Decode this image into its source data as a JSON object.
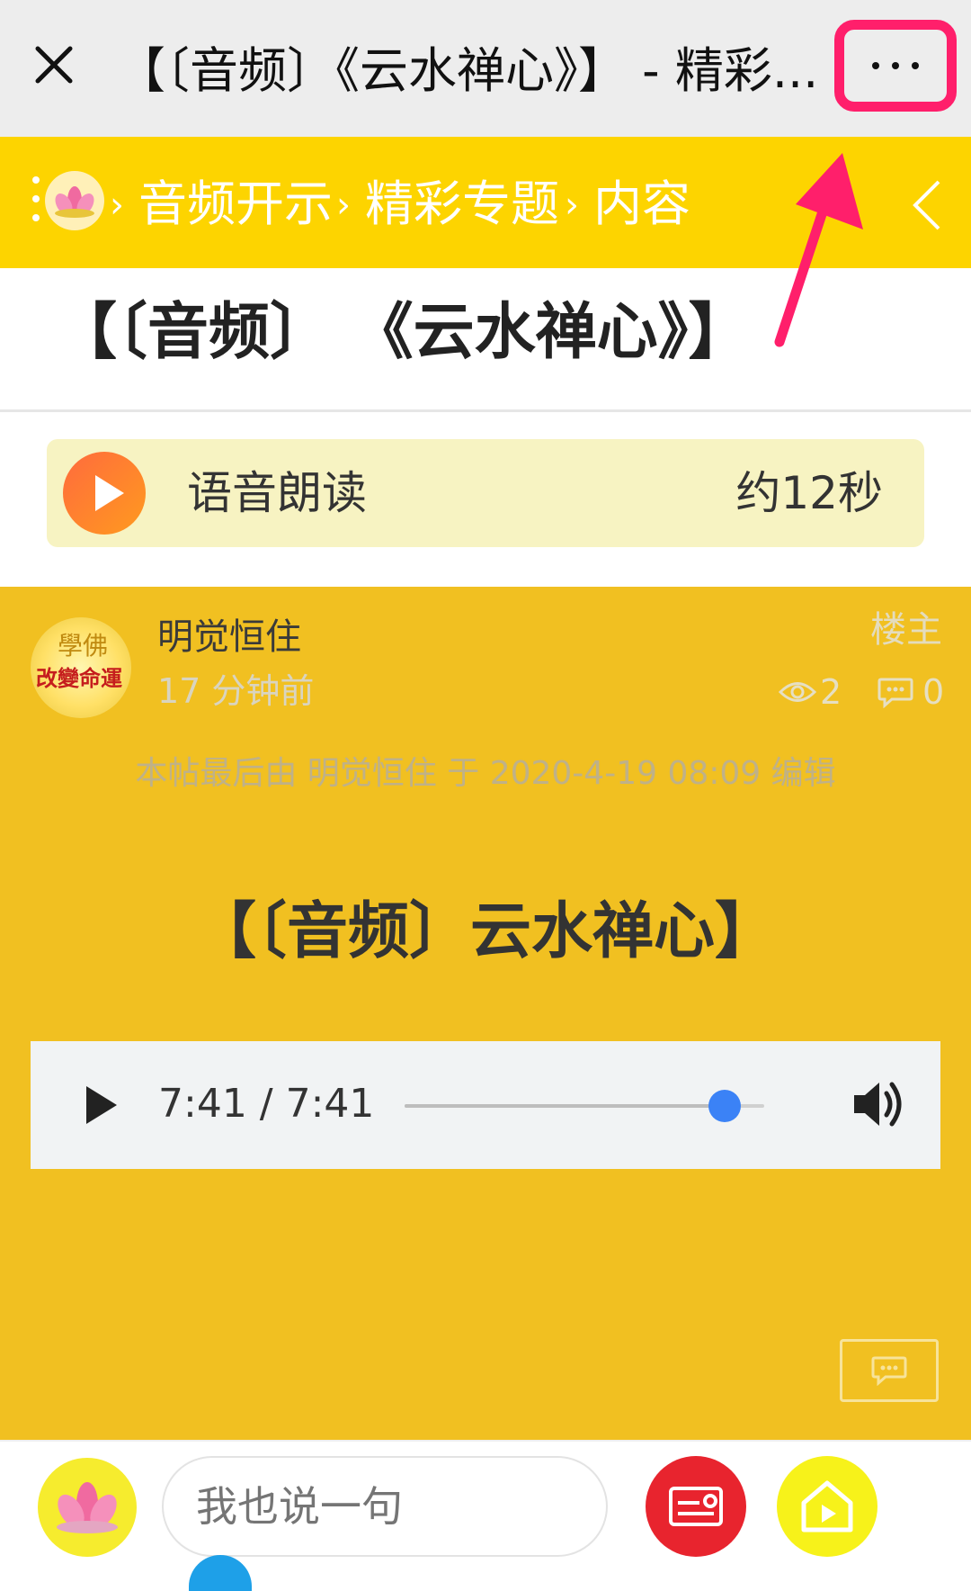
{
  "window": {
    "title": "【〔音频〕《云水禅心》】 - 精彩...",
    "close_icon": "close-icon",
    "more_icon": "more-dots-icon",
    "highlight_color": "#ff1f6b"
  },
  "breadcrumb": {
    "items": [
      "音频开示",
      "精彩专题",
      "内容"
    ],
    "separator": "›",
    "bar_color": "#fdd400"
  },
  "page": {
    "title": "【〔音频〕 《云水禅心》】"
  },
  "tts": {
    "label": "语音朗读",
    "duration": "约12秒"
  },
  "post": {
    "author": "明觉恒住",
    "time": "17 分钟前",
    "owner_badge": "楼主",
    "views": "2",
    "comments": "0",
    "edit_note": "本帖最后由 明觉恒住 于 2020-4-19 08:09 编辑",
    "title": "【〔音频〕云水禅心】",
    "avatar_text_top": "學佛",
    "avatar_text_bottom": "改變命運",
    "background": "#f1c021"
  },
  "audio_player": {
    "time": "7:41 / 7:41",
    "progress": 0.89
  },
  "bottom_bar": {
    "input_placeholder": "我也说一句"
  }
}
